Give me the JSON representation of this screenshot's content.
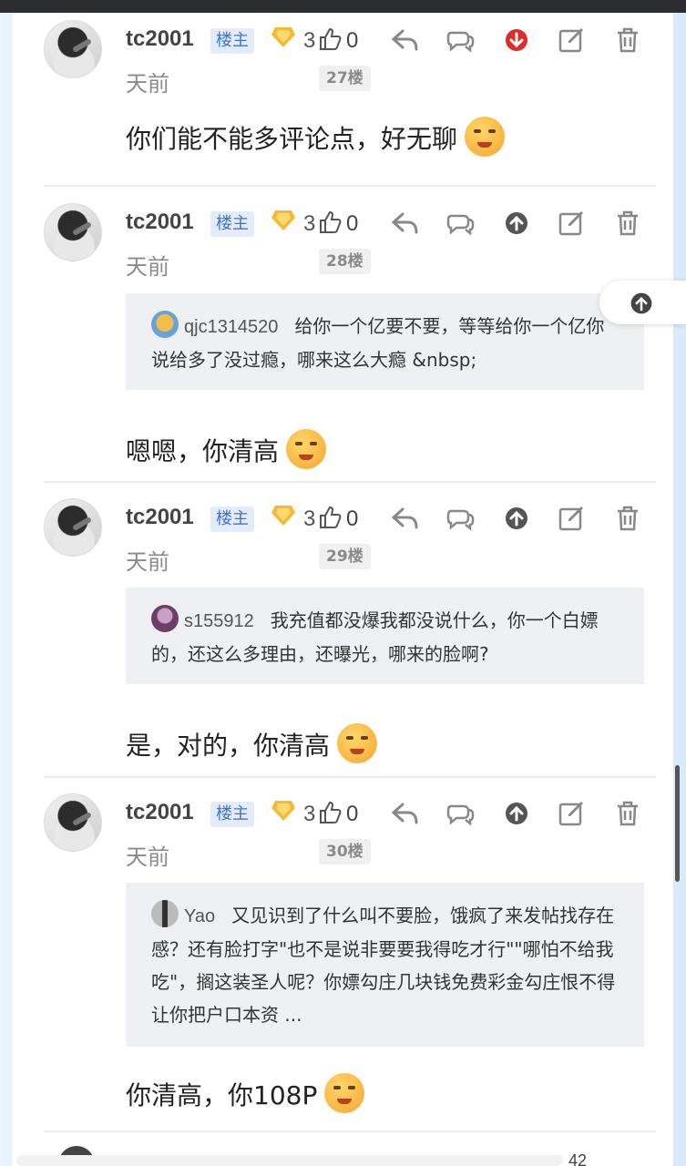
{
  "colors": {
    "owner_badge_bg": "#e4ecfb",
    "owner_badge_text": "#3f72d8",
    "downvote_active": "#e02b2b",
    "quote_bg": "#eef0f3"
  },
  "comments": [
    {
      "username": "tc2001",
      "owner_badge": "楼主",
      "level": "3",
      "likes": "0",
      "days": "天前",
      "floor": "27楼",
      "vote": "down-active",
      "quote": null,
      "text": "你们能不能多评论点，好无聊"
    },
    {
      "username": "tc2001",
      "owner_badge": "楼主",
      "level": "3",
      "likes": "0",
      "days": "天前",
      "floor": "28楼",
      "vote": "up",
      "quote": {
        "user": "qjc1314520",
        "text": "给你一个亿要不要，等等给你一个亿你说给多了没过瘾，哪来这么大瘾 &nbsp;"
      },
      "text": "嗯嗯，你清高"
    },
    {
      "username": "tc2001",
      "owner_badge": "楼主",
      "level": "3",
      "likes": "0",
      "days": "天前",
      "floor": "29楼",
      "vote": "up",
      "quote": {
        "user": "s155912",
        "text": "我充值都没爆我都没说什么，你一个白嫖的，还这么多理由，还曝光，哪来的脸啊?"
      },
      "text": "是，对的，你清高"
    },
    {
      "username": "tc2001",
      "owner_badge": "楼主",
      "level": "3",
      "likes": "0",
      "days": "天前",
      "floor": "30楼",
      "vote": "up",
      "quote": {
        "user": "Yao",
        "text": "又见识到了什么叫不要脸，饿疯了来发帖找存在感？还有脸打字\"也不是说非要要我得吃才行\"\"哪怕不给我吃\"，搁这装圣人呢？你嫖勾庄几块钱免费彩金勾庄恨不得让你把户口本资 ..."
      },
      "text": "你清高，你108P"
    }
  ],
  "bottom_bar": {
    "count": "42"
  }
}
